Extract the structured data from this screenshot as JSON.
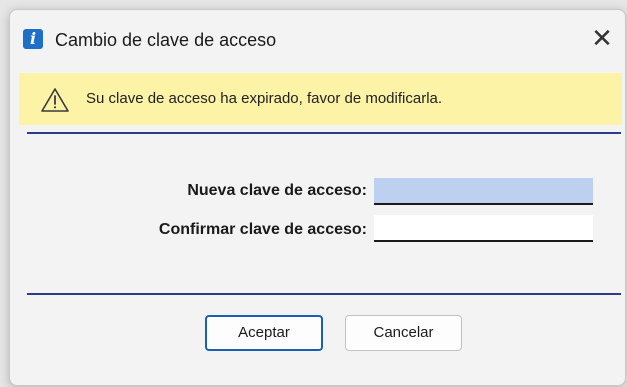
{
  "window": {
    "title": "Cambio de clave de acceso",
    "app_icon_glyph": "i",
    "close_glyph": "✕"
  },
  "warning": {
    "icon": "warning-triangle-icon",
    "message": "Su clave de acceso ha expirado, favor de modificarla."
  },
  "form": {
    "new_password_label": "Nueva clave de acceso:",
    "new_password_value": "",
    "confirm_password_label": "Confirmar clave de acceso:",
    "confirm_password_value": ""
  },
  "buttons": {
    "accept_label": "Aceptar",
    "cancel_label": "Cancelar"
  },
  "colors": {
    "warning_background": "#fcf3a7",
    "divider": "#2b3a8c",
    "focused_field": "#bed0f0",
    "accent_border": "#1b5fb5"
  }
}
